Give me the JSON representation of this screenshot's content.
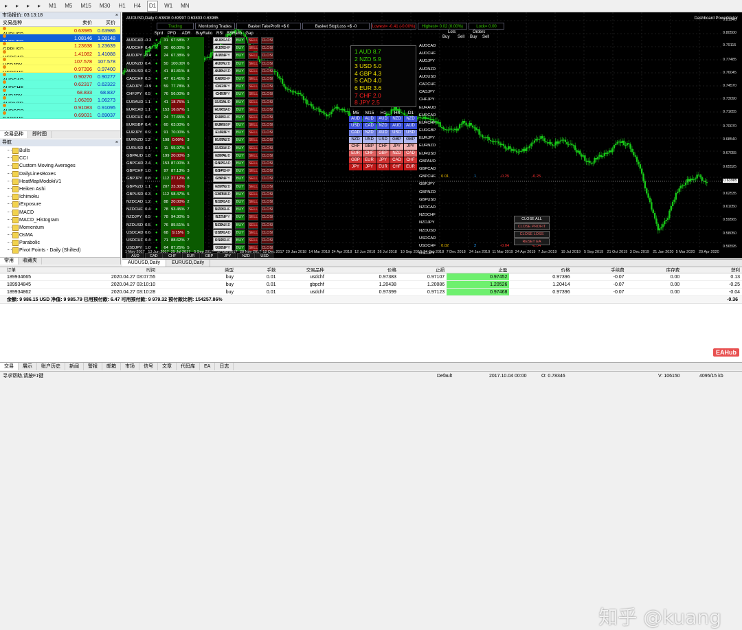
{
  "toolbar": {
    "items": [
      "M1",
      "M5",
      "M15",
      "M30",
      "H1",
      "H4",
      "D1",
      "W1",
      "MN"
    ],
    "active": "D1"
  },
  "market_watch": {
    "title": "市场报价: 03:13:18",
    "headers": [
      "交易品种",
      "卖价",
      "买价"
    ],
    "rows": [
      {
        "symbol": "AUDUSD",
        "bid": "0.63985",
        "ask": "0.63986",
        "bg": "#ffff66"
      },
      {
        "symbol": "EURUSD",
        "bid": "1.08146",
        "ask": "1.08148",
        "bg": "#1060d8",
        "selected": true
      },
      {
        "symbol": "GBPUSD",
        "bid": "1.23638",
        "ask": "1.23639",
        "bg": "#ffff66"
      },
      {
        "symbol": "USDCAD",
        "bid": "1.41082",
        "ask": "1.41088",
        "bg": "#ffff66"
      },
      {
        "symbol": "USDJPY",
        "bid": "107.578",
        "ask": "107.578",
        "bg": "#ffff66"
      },
      {
        "symbol": "USDCHF",
        "bid": "0.97396",
        "ask": "0.97400",
        "bg": "#ffff66"
      },
      {
        "symbol": "AUDCAD",
        "bid": "0.90270",
        "ask": "0.90277",
        "bg": "#66ffdd"
      },
      {
        "symbol": "AUDCHF",
        "bid": "0.62317",
        "ask": "0.62322",
        "bg": "#66ffdd"
      },
      {
        "symbol": "AUDJPY",
        "bid": "68.833",
        "ask": "68.837",
        "bg": "#66ffdd"
      },
      {
        "symbol": "AUDNZD",
        "bid": "1.06269",
        "ask": "1.06273",
        "bg": "#66ffdd"
      },
      {
        "symbol": "AUDSGD",
        "bid": "0.91083",
        "ask": "0.91095",
        "bg": "#66ffdd"
      },
      {
        "symbol": "CADCHF",
        "bid": "0.69031",
        "ask": "0.69037",
        "bg": "#66ffdd"
      }
    ],
    "tabs": [
      "交易品种",
      "即时图"
    ]
  },
  "navigator": {
    "title": "导航",
    "items": [
      "Bulls",
      "CCI",
      "Custom Moving Averages",
      "DailyLinesBoxes",
      "HeatMapModokiV1",
      "Heiken Ashi",
      "Ichimoku",
      "iExposure",
      "MACD",
      "MACD_Histogram",
      "Momentum",
      "OsMA",
      "Parabolic",
      "Pivot Points - Daily (Shifted)"
    ],
    "tabs": [
      "常用",
      "收藏夹"
    ]
  },
  "chart": {
    "title": "AUDUSD,Daily  0.63808 0.63997 0.63803 0.63985",
    "indicator": "Dashboard PowerMeter",
    "status_bar": [
      {
        "label": "Trading",
        "color": "#38b000"
      },
      {
        "label": "Monitoring Trades",
        "color": "#ffffff"
      },
      {
        "label": "Basket TakeProfit =$ 0",
        "color": "#ffffff"
      },
      {
        "label": "Basket StopLoss =$ -0",
        "color": "#ffffff"
      },
      {
        "label": "Lowest= -0.41 (-0.00%)",
        "color": "#ff2020"
      },
      {
        "label": "Highest= 0.02 (0.00%)",
        "color": "#38d000"
      },
      {
        "label": "Lock= 0.00",
        "color": "#38d000"
      }
    ],
    "price_ticks": [
      "0.81940",
      "0.80500",
      "0.79115",
      "0.77485",
      "0.76045",
      "0.74570",
      "0.73090",
      "0.71655",
      "0.70070",
      "0.68540",
      "0.67055",
      "0.65525",
      "0.63985",
      "0.62535",
      "0.61050",
      "0.59565",
      "0.58050",
      "0.56595"
    ],
    "current_price": "0.63985",
    "date_ticks": [
      "1 May 2017",
      "13 Jun 2017",
      "25 Jul 2017",
      "5 Sep 2017",
      "17 Oct 2017",
      "28 Nov 2017",
      "12 Dec 2017",
      "29 Jan 2018",
      "14 Mar 2018",
      "24 Apr 2018",
      "12 Jun 2018",
      "26 Jul 2018",
      "10 Sep 2018",
      "24 Oct 2018",
      "7 Dec 2018",
      "24 Jan 2019",
      "11 Mar 2019",
      "24 Apr 2019",
      "7 Jun 2019",
      "19 Jul 2019",
      "5 Sep 2019",
      "21 Oct 2019",
      "3 Dec 2019",
      "21 Jan 2020",
      "5 Mar 2020",
      "20 Apr 2020"
    ],
    "price_series": [
      0.76,
      0.768,
      0.778,
      0.79,
      0.795,
      0.8,
      0.785,
      0.776,
      0.772,
      0.78,
      0.792,
      0.805,
      0.81,
      0.795,
      0.776,
      0.77,
      0.758,
      0.742,
      0.738,
      0.728,
      0.72,
      0.712,
      0.723,
      0.718,
      0.705,
      0.708,
      0.7,
      0.712,
      0.722,
      0.715,
      0.708,
      0.712,
      0.708,
      0.7,
      0.695,
      0.705,
      0.702,
      0.69,
      0.685,
      0.68,
      0.675,
      0.672,
      0.683,
      0.688,
      0.68,
      0.685,
      0.682,
      0.67,
      0.66,
      0.668,
      0.672,
      0.685,
      0.68,
      0.66,
      0.62,
      0.585,
      0.6,
      0.63,
      0.64,
      0.645,
      0.64
    ],
    "panel": {
      "headers": [
        "Sprd",
        "PFO",
        "ADR",
        "BuyRatio",
        "RSI",
        "BSRatio",
        "Gap"
      ],
      "pairs": [
        "AUDCAD",
        "AUDCHF",
        "AUDJPY",
        "AUDNZD",
        "AUDUSD",
        "CADCHF",
        "CADJPY",
        "CHFJPY",
        "EURAUD",
        "EURCAD",
        "EURCHF",
        "EURGBP",
        "EURJPY",
        "EURNZD",
        "EURUSD",
        "GBPAUD",
        "GBPCAD",
        "GBPCHF",
        "GBPJPY",
        "GBPNZD",
        "GBPUSD",
        "NZDCAD",
        "NZDCHF",
        "NZDJPY",
        "NZDUSD",
        "USDCAD",
        "USDCHF",
        "USDJPY"
      ],
      "pct": [
        "0.16%",
        "0.12%",
        "0.15%",
        "0.01%",
        "0.05%",
        "0.05%",
        "-0.12%",
        "-0.03%",
        "-0.11%",
        "-0.10%",
        "0.03%",
        "0.05%",
        "-0.06%",
        "-0.13%",
        "-0.11%",
        "-0.03%",
        "0.10%",
        "0.14%",
        "0.06%",
        "-0.15%",
        "-0.01%",
        "0.18%",
        "0.20%",
        "0.17%",
        "0.09%",
        "0.05%",
        "0.14%",
        "0.09%"
      ],
      "sprd": [
        "-0.3",
        "0.4",
        "-0.4",
        "0.4",
        "0.2",
        "0.3",
        "-0.9",
        "0.5",
        "1.1",
        "1.1",
        "0.6",
        "0.4",
        "0.9",
        "1.2",
        "0.1",
        "1.8",
        "2.4",
        "1.0",
        "0.8",
        "1.1",
        "0.3",
        "1.2",
        "0.4",
        "0.5",
        "0.5",
        "0.6",
        "0.4",
        "1.0"
      ],
      "adr": [
        "31",
        "36",
        "24",
        "50",
        "41",
        "47",
        "59",
        "76",
        "41",
        "153",
        "24",
        "60",
        "91",
        "198",
        "11",
        "199",
        "153",
        "97",
        "112",
        "207",
        "112",
        "88",
        "78",
        "78",
        "76",
        "68",
        "71",
        "64"
      ],
      "buyratio": [
        "67.58%",
        "60.00%",
        "67.38%",
        "100.00%",
        "81.81%",
        "61.41%",
        "77.78%",
        "56.00%",
        "18.75%",
        "16.67%",
        "77.65%",
        "63.00%",
        "70.00%",
        "0.00%",
        "55.97%",
        "20.00%",
        "87.00%",
        "87.13%",
        "27.12%",
        "23.30%",
        "58.47%",
        "20.00%",
        "93.45%",
        "94.30%",
        "85.51%",
        "9.15%",
        "88.62%",
        "87.25%"
      ],
      "rsi": [
        "7",
        "9",
        "9",
        "6",
        "8",
        "3",
        "3",
        "8",
        "1",
        "1",
        "3",
        "6",
        "5",
        "3",
        "5",
        "3",
        "3",
        "3",
        "8",
        "9",
        "5",
        "2",
        "7",
        "5",
        "5",
        "5",
        "7",
        "5"
      ],
      "buy": "BUY",
      "sell": "SELL",
      "close": "CLOSE",
      "currencies": [
        "AUD",
        "CAD",
        "CHF",
        "EUR",
        "GBP",
        "JPY",
        "NZD",
        "USD"
      ],
      "bottom_labels": {
        "buy": "BUY",
        "sell": "SELL",
        "close": "CLOSE"
      }
    },
    "strength": [
      {
        "label": "1 AUD 8.7",
        "color": "#38d000"
      },
      {
        "label": "2 NZD 5.9",
        "color": "#38d000"
      },
      {
        "label": "3 USD 5.0",
        "color": "#f0e000"
      },
      {
        "label": "4 GBP 4.3",
        "color": "#f0e000"
      },
      {
        "label": "5 CAD 4.0",
        "color": "#f0e000"
      },
      {
        "label": "6 EUR 3.6",
        "color": "#f0e000"
      },
      {
        "label": "7 CHF 2.0",
        "color": "#ff2020"
      },
      {
        "label": "8 JPY 2.5",
        "color": "#ff2020"
      }
    ],
    "tf_headers": [
      "M5",
      "M15",
      "H1",
      "H4",
      "D1"
    ],
    "tf_grid": [
      [
        "AUD",
        "AUD",
        "AUD",
        "NZD",
        "NZD"
      ],
      [
        "USD",
        "CAD",
        "NZD",
        "AUD",
        "AUD"
      ],
      [
        "CAD",
        "NZD",
        "AUD",
        "USD",
        "USD"
      ],
      [
        "NZD",
        "USD",
        "USD",
        "GBP",
        "GBP"
      ],
      [
        "CHF",
        "GBP",
        "CHF",
        "JPY",
        "JPY"
      ],
      [
        "EUR",
        "CHF",
        "GBP",
        "NZD",
        "CAD"
      ],
      [
        "GBP",
        "EUR",
        "JPY",
        "CAD",
        "CHF"
      ],
      [
        "JPY",
        "JPY",
        "EUR",
        "CHF",
        "EUR"
      ]
    ],
    "right_panel": {
      "headers": {
        "lots": "Lots",
        "orders": "Orders",
        "buy": "Buy",
        "sell": "Sell"
      },
      "gbpchf": {
        "buy": "0.01",
        "orders": "1",
        "pl": "-0.25",
        "lock": "-0.25"
      },
      "usdchf": {
        "buy": "0.02",
        "orders": "2",
        "pl": "-0.04",
        "lock": "-0.04"
      },
      "buttons": [
        "CLOSE ALL",
        "CLOSE PROFIT",
        "CLOSE LOSS",
        "RESET EA"
      ]
    }
  },
  "chart_tabs": [
    "AUDUSD,Daily",
    "EURUSD,Daily"
  ],
  "trades": {
    "headers": [
      "订单",
      "时间",
      "类型",
      "手数",
      "交易品种",
      "价格",
      "止损",
      "止盈",
      "价格",
      "手续费",
      "库存费",
      "获利"
    ],
    "rows": [
      [
        "189934665",
        "2020.04.27 03:07:55",
        "buy",
        "0.01",
        "usdchf",
        "0.97383",
        "0.97107",
        "0.97452",
        "0.97396",
        "-0.07",
        "0.00",
        "0.13"
      ],
      [
        "189934845",
        "2020.04.27 03:10:10",
        "buy",
        "0.01",
        "gbpchf",
        "1.20438",
        "1.20086",
        "1.20526",
        "1.20414",
        "-0.07",
        "0.00",
        "-0.25"
      ],
      [
        "189934862",
        "2020.04.27 03:10:28",
        "buy",
        "0.01",
        "usdchf",
        "0.97399",
        "0.97123",
        "0.97468",
        "0.97396",
        "-0.07",
        "0.00",
        "-0.04"
      ]
    ],
    "balance": "余额: 9 986.15 USD  净值: 9 985.79  已用预付款: 6.47  可用预付款: 9 979.32  预付款比例: 154257.86%",
    "balance_pl": "-0.36"
  },
  "bottom_tabs": [
    "交易",
    "展示",
    "账户历史",
    "新闻",
    "警报",
    "邮箱",
    "市场",
    "信号",
    "文章",
    "代码库",
    "EA",
    "日志"
  ],
  "status": {
    "help": "寻求帮助,请按F1键",
    "profile": "Default",
    "datetime": "2017.10.04 00:00",
    "o": "O: 0.78346",
    "v": "V: 106150",
    "traffic": "4095/15 kb"
  },
  "watermark": "知乎 @kuang",
  "badge": "EAHub"
}
